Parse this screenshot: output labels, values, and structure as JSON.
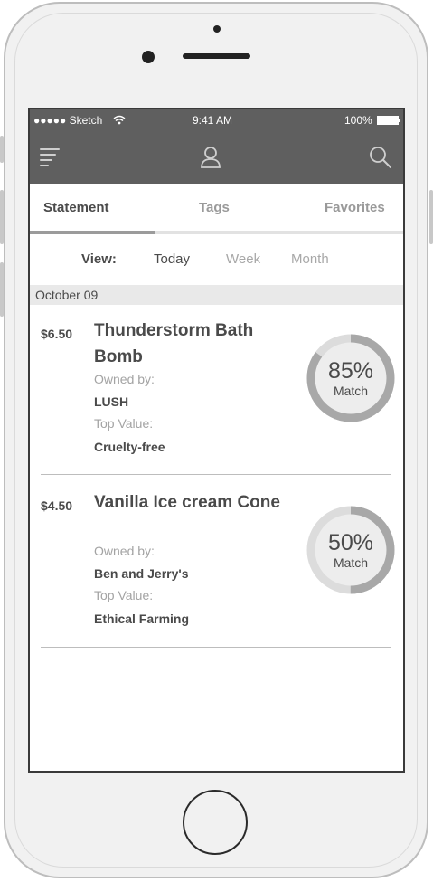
{
  "status_bar": {
    "carrier": "●●●●● Sketch",
    "time": "9:41 AM",
    "battery": "100%"
  },
  "nav": {
    "menu_icon": "menu-icon",
    "profile_icon": "user-icon",
    "search_icon": "search-icon"
  },
  "tabs": [
    {
      "label": "Statement",
      "active": true
    },
    {
      "label": "Tags",
      "active": false
    },
    {
      "label": "Favorites",
      "active": false
    }
  ],
  "view": {
    "label": "View:",
    "options": [
      "Today",
      "Week",
      "Month"
    ],
    "selected": "Today"
  },
  "date_header": "October 09",
  "items": [
    {
      "price": "$6.50",
      "name": "Thunderstorm Bath Bomb",
      "owned_label": "Owned by:",
      "owner": "LUSH",
      "value_label": "Top Value:",
      "value": "Cruelty-free",
      "match_percent": "85%",
      "match_label": "Match",
      "match_fraction": 0.85
    },
    {
      "price": "$4.50",
      "name": "Vanilla Ice cream Cone",
      "owned_label": "Owned by:",
      "owner": "Ben and Jerry's",
      "value_label": "Top Value:",
      "value": "Ethical Farming",
      "match_percent": "50%",
      "match_label": "Match",
      "match_fraction": 0.5
    }
  ],
  "colors": {
    "bar": "#5f5f5f",
    "gauge_fill": "#a8a8a8",
    "gauge_track": "#dcdcdc"
  }
}
